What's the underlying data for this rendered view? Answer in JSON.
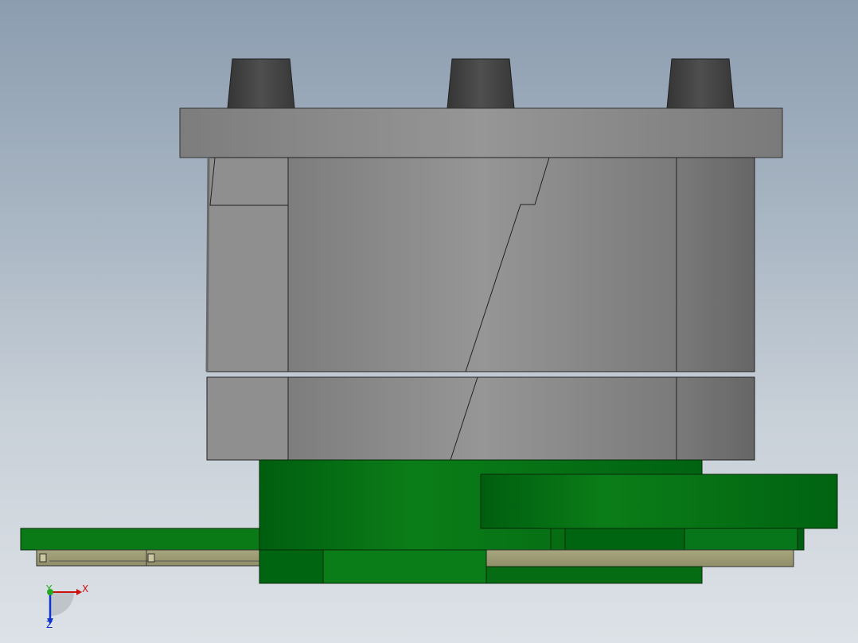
{
  "viewport": {
    "background_top": "#8c9db0",
    "background_bottom": "#dde2e7"
  },
  "model": {
    "steel_color": "#8e8e8e",
    "steel_dark": "#6e6e6e",
    "rubber_color": "#444444",
    "pcb_green": "#0a7a16",
    "pcb_dark": "#005f10",
    "tan_color": "#9b9a72"
  },
  "triad": {
    "x_label": "X",
    "y_label": "Y",
    "z_label": "Z",
    "x_color": "#cc1111",
    "y_color": "#22aa22",
    "z_color": "#1133cc"
  }
}
